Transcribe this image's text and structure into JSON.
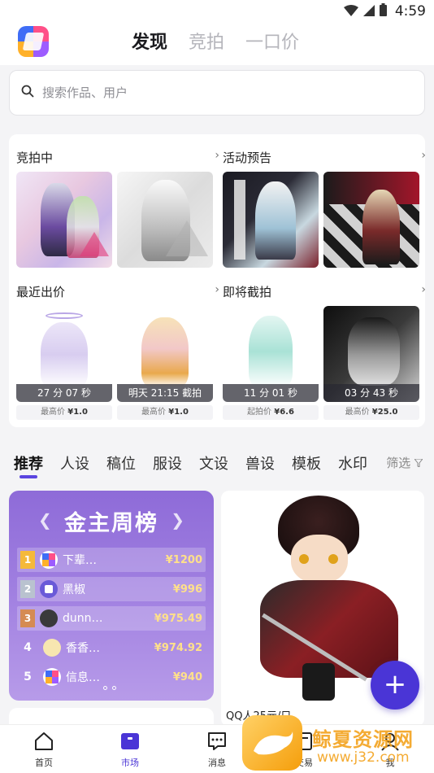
{
  "status_bar": {
    "time": "4:59"
  },
  "header": {
    "tabs": [
      {
        "label": "发现",
        "active": true
      },
      {
        "label": "竞拍",
        "active": false
      },
      {
        "label": "一口价",
        "active": false
      }
    ]
  },
  "search": {
    "placeholder": "搜索作品、用户"
  },
  "sections": {
    "auctioning": {
      "title": "竞拍中"
    },
    "preview": {
      "title": "活动预告"
    },
    "recent": {
      "title": "最近出价",
      "items": [
        {
          "caption": "27 分 07 秒",
          "price_label": "最高价",
          "price": "¥1.0"
        },
        {
          "caption": "明天 21:15 截拍",
          "price_label": "最高价",
          "price": "¥1.0"
        }
      ]
    },
    "ending": {
      "title": "即将截拍",
      "items": [
        {
          "caption": "11 分 01 秒",
          "price_label": "起拍价",
          "price": "¥6.6"
        },
        {
          "caption": "03 分 43 秒",
          "price_label": "最高价",
          "price": "¥25.0"
        }
      ]
    }
  },
  "categories": {
    "items": [
      "推荐",
      "人设",
      "稿位",
      "服设",
      "文设",
      "兽设",
      "模板",
      "水印"
    ],
    "filter_label": "筛选"
  },
  "ranking": {
    "title": "金主周榜",
    "rows": [
      {
        "rank": "1",
        "name": "下辈…",
        "amount": "¥1200"
      },
      {
        "rank": "2",
        "name": "黑椒",
        "amount": "¥996"
      },
      {
        "rank": "3",
        "name": "dunn…",
        "amount": "¥975.49"
      },
      {
        "rank": "4",
        "name": "香香…",
        "amount": "¥974.92"
      },
      {
        "rank": "5",
        "name": "信息…",
        "amount": "¥940"
      }
    ]
  },
  "artwork": {
    "caption": "QQ人25元/只"
  },
  "fab": {
    "label": "+"
  },
  "bottom_nav": [
    {
      "label": "首页",
      "active": false
    },
    {
      "label": "市场",
      "active": true
    },
    {
      "label": "消息",
      "active": false
    },
    {
      "label": "交易",
      "active": false
    },
    {
      "label": "我",
      "active": false
    }
  ],
  "watermark": {
    "text": "鲸夏资源网",
    "url": "www.j32.com"
  },
  "colors": {
    "accent": "#4a35d6",
    "rank_gold": "#ffe08a"
  }
}
